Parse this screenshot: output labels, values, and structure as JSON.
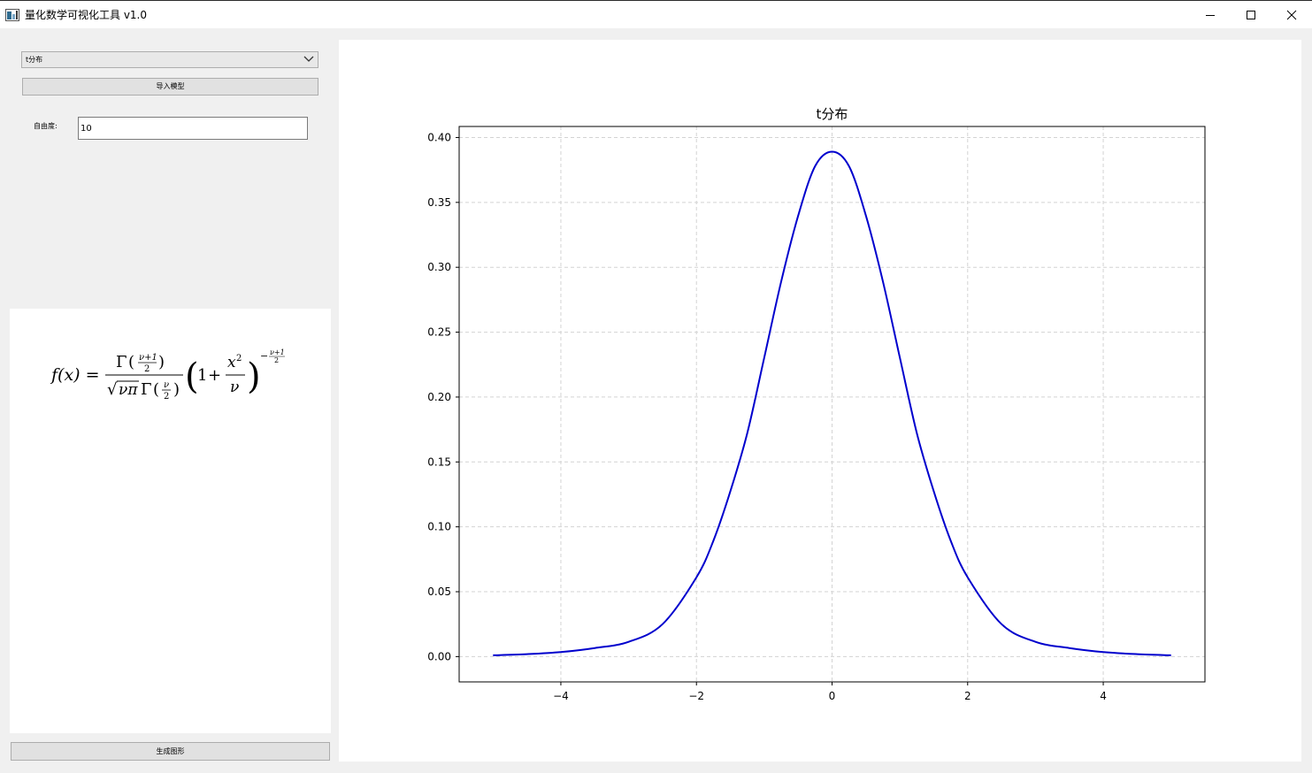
{
  "window": {
    "title": "量化数学可视化工具 v1.0",
    "controls": {
      "minimize": "minimize-icon",
      "maximize": "maximize-icon",
      "close": "close-icon"
    }
  },
  "sidebar": {
    "model_select": {
      "selected": "t分布"
    },
    "import_button": "导入模型",
    "dof_label": "自由度:",
    "dof_value": "10",
    "formula": {
      "lhs": "f(x) =",
      "latex": "f(x)=\\frac{\\Gamma\\left(\\frac{\\nu+1}{2}\\right)}{\\sqrt{\\nu\\pi}\\,\\Gamma\\left(\\frac{\\nu}{2}\\right)}\\left(1+\\frac{x^2}{\\nu}\\right)^{-\\frac{\\nu+1}{2}}"
    },
    "generate_button": "生成图形"
  },
  "colors": {
    "line": "#0000cd",
    "grid": "#d3d3d3",
    "background": "#f0f0f0"
  },
  "chart_data": {
    "type": "line",
    "title": "t分布",
    "xlabel": "",
    "ylabel": "",
    "xlim": [
      -5.5,
      5.5
    ],
    "ylim": [
      -0.0195,
      0.4085
    ],
    "xticks": [
      -4,
      -2,
      0,
      2,
      4
    ],
    "xtick_labels": [
      "−4",
      "−2",
      "0",
      "2",
      "4"
    ],
    "yticks": [
      0.0,
      0.05,
      0.1,
      0.15,
      0.2,
      0.25,
      0.3,
      0.35,
      0.4
    ],
    "ytick_labels": [
      "0.00",
      "0.05",
      "0.10",
      "0.15",
      "0.20",
      "0.25",
      "0.30",
      "0.35",
      "0.40"
    ],
    "grid": true,
    "grid_style": "dashed",
    "legend": "none",
    "series": [
      {
        "x": [
          -5,
          -4.5,
          -4,
          -3.5,
          -3,
          -2.5,
          -2,
          -1.75,
          -1.5,
          -1.25,
          -1,
          -0.75,
          -0.5,
          -0.25,
          0,
          0.25,
          0.5,
          0.75,
          1,
          1.25,
          1.5,
          1.75,
          2,
          2.5,
          3,
          3.5,
          4,
          4.5,
          5
        ],
        "y": [
          0.001,
          0.0019,
          0.0035,
          0.0066,
          0.0114,
          0.025,
          0.0611,
          0.0893,
          0.1274,
          0.1723,
          0.2304,
          0.2891,
          0.3397,
          0.3779,
          0.3891,
          0.3779,
          0.3397,
          0.2891,
          0.2304,
          0.1723,
          0.1274,
          0.0893,
          0.0611,
          0.025,
          0.0114,
          0.0066,
          0.0035,
          0.0019,
          0.001
        ]
      }
    ]
  }
}
